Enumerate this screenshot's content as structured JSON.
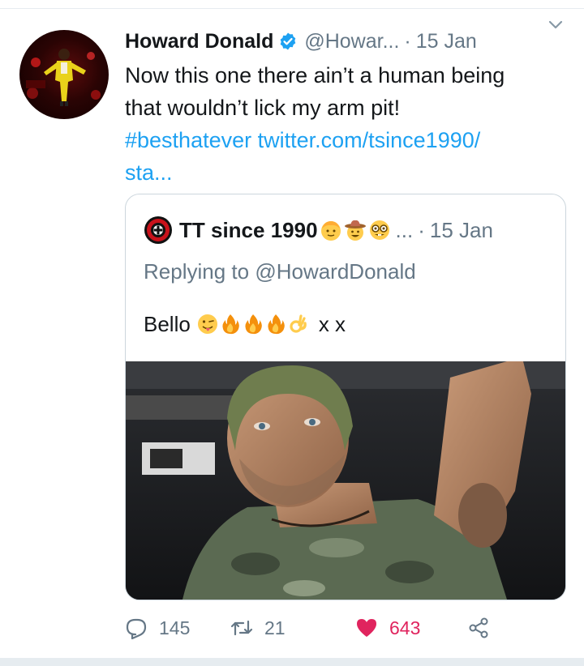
{
  "tweet": {
    "display_name": "Howard Donald",
    "handle": "@Howar...",
    "separator": "·",
    "time": "15 Jan",
    "text_lines": [
      "Now this one there ain’t a human being",
      "that wouldn’t lick my arm pit!"
    ],
    "hashtag": "#besthatever",
    "link_line1": "twitter.com/tsince1990/",
    "link_line2": "sta..."
  },
  "quote": {
    "display_name": "TT since 1990",
    "ellipsis": "...",
    "separator": "·",
    "time": "15 Jan",
    "replying_prefix": "Replying to",
    "replying_to": "@HowardDonald",
    "text": "Bello",
    "text_suffix": "x x",
    "name_emojis": [
      "blond-face",
      "cowboy-face",
      "nerd-face"
    ],
    "text_emojis": [
      "tongue-wink-face",
      "fire",
      "fire",
      "fire",
      "ok-hand"
    ]
  },
  "actions": {
    "reply_count": "145",
    "retweet_count": "21",
    "like_count": "643"
  },
  "colors": {
    "link": "#1da1f2",
    "like": "#e0245e",
    "muted": "#657786",
    "verified": "#1da1f2"
  }
}
